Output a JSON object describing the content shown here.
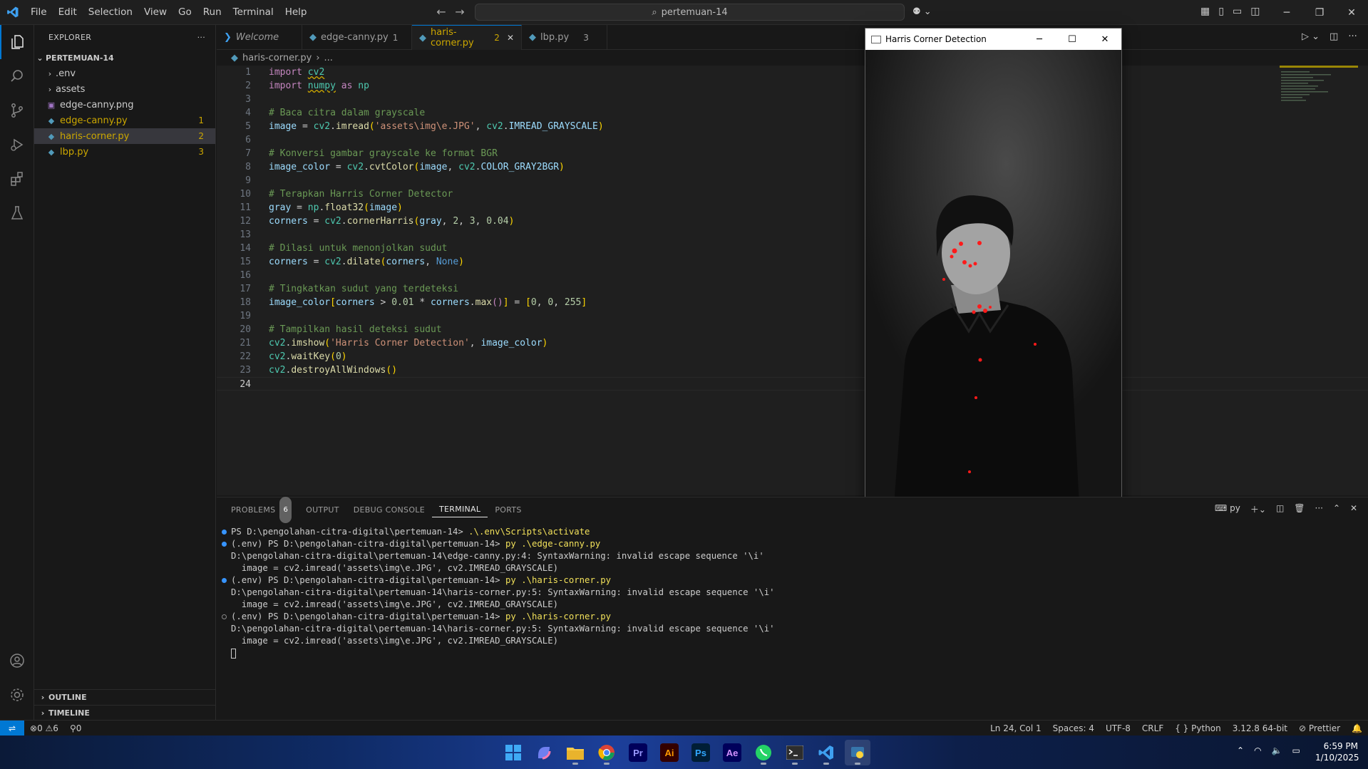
{
  "titlebar": {
    "menu": [
      "File",
      "Edit",
      "Selection",
      "View",
      "Go",
      "Run",
      "Terminal",
      "Help"
    ],
    "search": "pertemuan-14"
  },
  "sidebar": {
    "title": "EXPLORER",
    "more": "···",
    "folder": "PERTEMUAN-14",
    "items": [
      {
        "label": ".env",
        "type": "folder"
      },
      {
        "label": "assets",
        "type": "folder"
      },
      {
        "label": "edge-canny.png",
        "type": "png",
        "badge": ""
      },
      {
        "label": "edge-canny.py",
        "type": "py",
        "badge": "1"
      },
      {
        "label": "haris-corner.py",
        "type": "py",
        "badge": "2"
      },
      {
        "label": "lbp.py",
        "type": "py",
        "badge": "3"
      }
    ],
    "outline": "OUTLINE",
    "timeline": "TIMELINE"
  },
  "tabs": [
    {
      "label": "Welcome",
      "badge": ""
    },
    {
      "label": "edge-canny.py",
      "badge": "1"
    },
    {
      "label": "haris-corner.py",
      "badge": "2"
    },
    {
      "label": "lbp.py",
      "badge": "3"
    }
  ],
  "breadcrumb": {
    "file": "haris-corner.py",
    "rest": "..."
  },
  "code_lines": [
    "1",
    "2",
    "3",
    "4",
    "5",
    "6",
    "7",
    "8",
    "9",
    "10",
    "11",
    "12",
    "13",
    "14",
    "15",
    "16",
    "17",
    "18",
    "19",
    "20",
    "21",
    "22",
    "23",
    "24"
  ],
  "harris_window": {
    "title": "Harris Corner Detection"
  },
  "panel": {
    "tabs": [
      "PROBLEMS",
      "OUTPUT",
      "DEBUG CONSOLE",
      "TERMINAL",
      "PORTS"
    ],
    "problems_count": "6",
    "shell": "py",
    "terminal": [
      {
        "prompt": "PS D:\\pengolahan-citra-digital\\pertemuan-14> ",
        "cmd": ".\\.env\\Scripts\\activate",
        "dot": "blue"
      },
      {
        "prompt": "(.env) PS D:\\pengolahan-citra-digital\\pertemuan-14> ",
        "cmd": "py .\\edge-canny.py",
        "dot": "blue"
      },
      {
        "prompt": "D:\\pengolahan-citra-digital\\pertemuan-14\\edge-canny.py:4: SyntaxWarning: invalid escape sequence '\\i'",
        "cmd": "",
        "dot": ""
      },
      {
        "prompt": "  image = cv2.imread('assets\\img\\e.JPG', cv2.IMREAD_GRAYSCALE)",
        "cmd": "",
        "dot": ""
      },
      {
        "prompt": "(.env) PS D:\\pengolahan-citra-digital\\pertemuan-14> ",
        "cmd": "py .\\haris-corner.py",
        "dot": "blue"
      },
      {
        "prompt": "D:\\pengolahan-citra-digital\\pertemuan-14\\haris-corner.py:5: SyntaxWarning: invalid escape sequence '\\i'",
        "cmd": "",
        "dot": ""
      },
      {
        "prompt": "  image = cv2.imread('assets\\img\\e.JPG', cv2.IMREAD_GRAYSCALE)",
        "cmd": "",
        "dot": ""
      },
      {
        "prompt": "(.env) PS D:\\pengolahan-citra-digital\\pertemuan-14> ",
        "cmd": "py .\\haris-corner.py",
        "dot": "hollow"
      },
      {
        "prompt": "D:\\pengolahan-citra-digital\\pertemuan-14\\haris-corner.py:5: SyntaxWarning: invalid escape sequence '\\i'",
        "cmd": "",
        "dot": ""
      },
      {
        "prompt": "  image = cv2.imread('assets\\img\\e.JPG', cv2.IMREAD_GRAYSCALE)",
        "cmd": "",
        "dot": ""
      }
    ]
  },
  "statusbar": {
    "errors": "0",
    "warnings": "6",
    "ports": "0",
    "position": "Ln 24, Col 1",
    "spaces": "Spaces: 4",
    "encoding": "UTF-8",
    "eol": "CRLF",
    "language": "Python",
    "interpreter": "3.12.8 64-bit",
    "formatter": "Prettier"
  },
  "taskbar": {
    "apps": [
      {
        "name": "windows-start",
        "label": ""
      },
      {
        "name": "copilot",
        "label": ""
      },
      {
        "name": "file-explorer",
        "label": ""
      },
      {
        "name": "chrome",
        "label": ""
      },
      {
        "name": "premiere",
        "label": "Pr"
      },
      {
        "name": "illustrator",
        "label": "Ai"
      },
      {
        "name": "photoshop",
        "label": "Ps"
      },
      {
        "name": "after-effects",
        "label": "Ae"
      },
      {
        "name": "whatsapp",
        "label": ""
      },
      {
        "name": "terminal",
        "label": ""
      },
      {
        "name": "vscode",
        "label": ""
      },
      {
        "name": "python",
        "label": ""
      }
    ],
    "time": "6:59 PM",
    "date": "1/10/2025"
  },
  "colors": {
    "accent": "#0078d4",
    "warning": "#cca700",
    "python_icon": "#519aba"
  }
}
